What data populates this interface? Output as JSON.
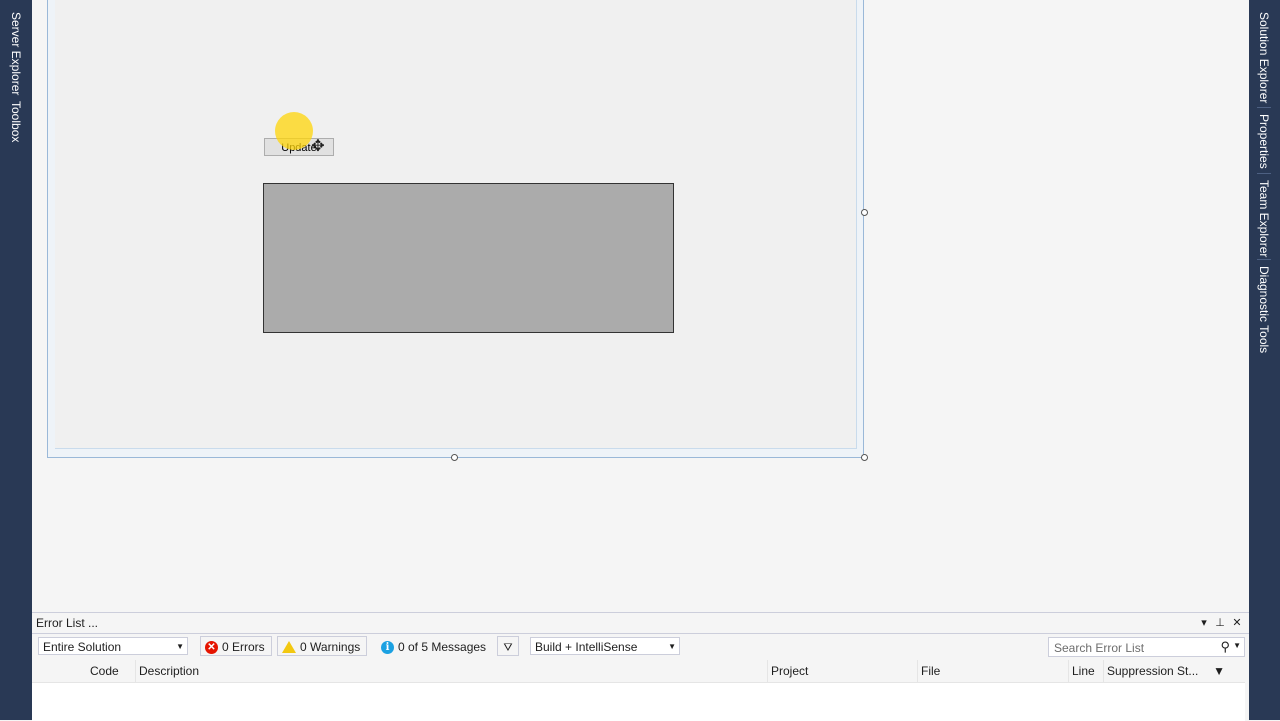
{
  "left_dock": {
    "tabs": [
      {
        "label": "Server Explorer"
      },
      {
        "label": "Toolbox"
      }
    ]
  },
  "right_dock": {
    "tabs": [
      {
        "label": "Solution Explorer"
      },
      {
        "label": "Properties"
      },
      {
        "label": "Team Explorer"
      },
      {
        "label": "Diagnostic Tools"
      }
    ]
  },
  "designer": {
    "update_button_label": "Update"
  },
  "error_list": {
    "title": "Error List ...",
    "scope_dropdown": "Entire Solution",
    "errors_label": "0 Errors",
    "warnings_label": "0 Warnings",
    "messages_label": "0 of 5 Messages",
    "build_dropdown": "Build + IntelliSense",
    "search_placeholder": "Search Error List",
    "columns": {
      "code": "Code",
      "description": "Description",
      "project": "Project",
      "file": "File",
      "line": "Line",
      "suppression": "Suppression St..."
    }
  },
  "colors": {
    "dock_background": "#293955",
    "error_icon": "#e51400",
    "warning_icon": "#f2c811",
    "info_icon": "#1ba1e2",
    "cursor_highlight": "#ffd60a",
    "panel_fill": "#ababab"
  }
}
